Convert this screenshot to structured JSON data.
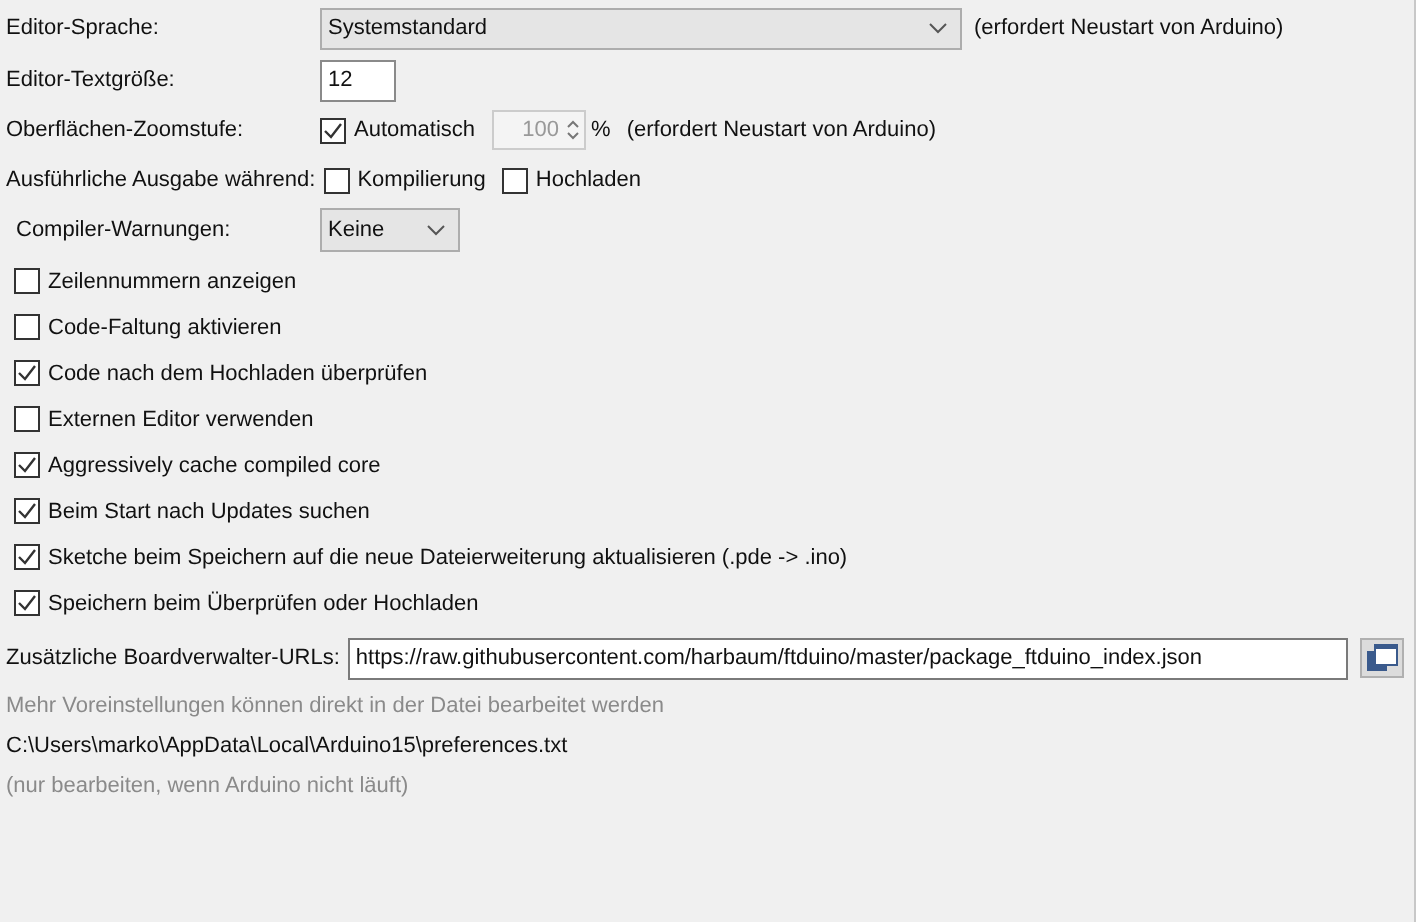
{
  "editor_language": {
    "label": "Editor-Sprache:",
    "value": "Systemstandard",
    "note": "(erfordert Neustart von Arduino)"
  },
  "editor_font_size": {
    "label": "Editor-Textgröße:",
    "value": "12"
  },
  "zoom": {
    "label": "Oberflächen-Zoomstufe:",
    "auto_label": "Automatisch",
    "auto_checked": true,
    "value": "100",
    "unit": "%",
    "note": "(erfordert Neustart von Arduino)"
  },
  "verbose": {
    "label": "Ausführliche Ausgabe während:",
    "options": [
      {
        "label": "Kompilierung",
        "checked": false
      },
      {
        "label": "Hochladen",
        "checked": false
      }
    ]
  },
  "compiler_warnings": {
    "label": "Compiler-Warnungen:",
    "value": "Keine"
  },
  "options": [
    {
      "label": "Zeilennummern anzeigen",
      "checked": false
    },
    {
      "label": "Code-Faltung aktivieren",
      "checked": false
    },
    {
      "label": "Code nach dem Hochladen überprüfen",
      "checked": true
    },
    {
      "label": "Externen Editor verwenden",
      "checked": false
    },
    {
      "label": "Aggressively cache compiled core",
      "checked": true
    },
    {
      "label": "Beim Start nach Updates suchen",
      "checked": true
    },
    {
      "label": "Sketche beim Speichern auf die neue Dateierweiterung aktualisieren (.pde -> .ino)",
      "checked": true
    },
    {
      "label": "Speichern beim Überprüfen oder Hochladen",
      "checked": true
    }
  ],
  "board_urls": {
    "label": "Zusätzliche Boardverwalter-URLs:",
    "value": "https://raw.githubusercontent.com/harbaum/ftduino/master/package_ftduino_index.json"
  },
  "more_info": "Mehr Voreinstellungen können direkt in der Datei bearbeitet werden",
  "prefs_path": "C:\\Users\\marko\\AppData\\Local\\Arduino15\\preferences.txt",
  "prefs_note": "(nur bearbeiten, wenn Arduino nicht läuft)"
}
